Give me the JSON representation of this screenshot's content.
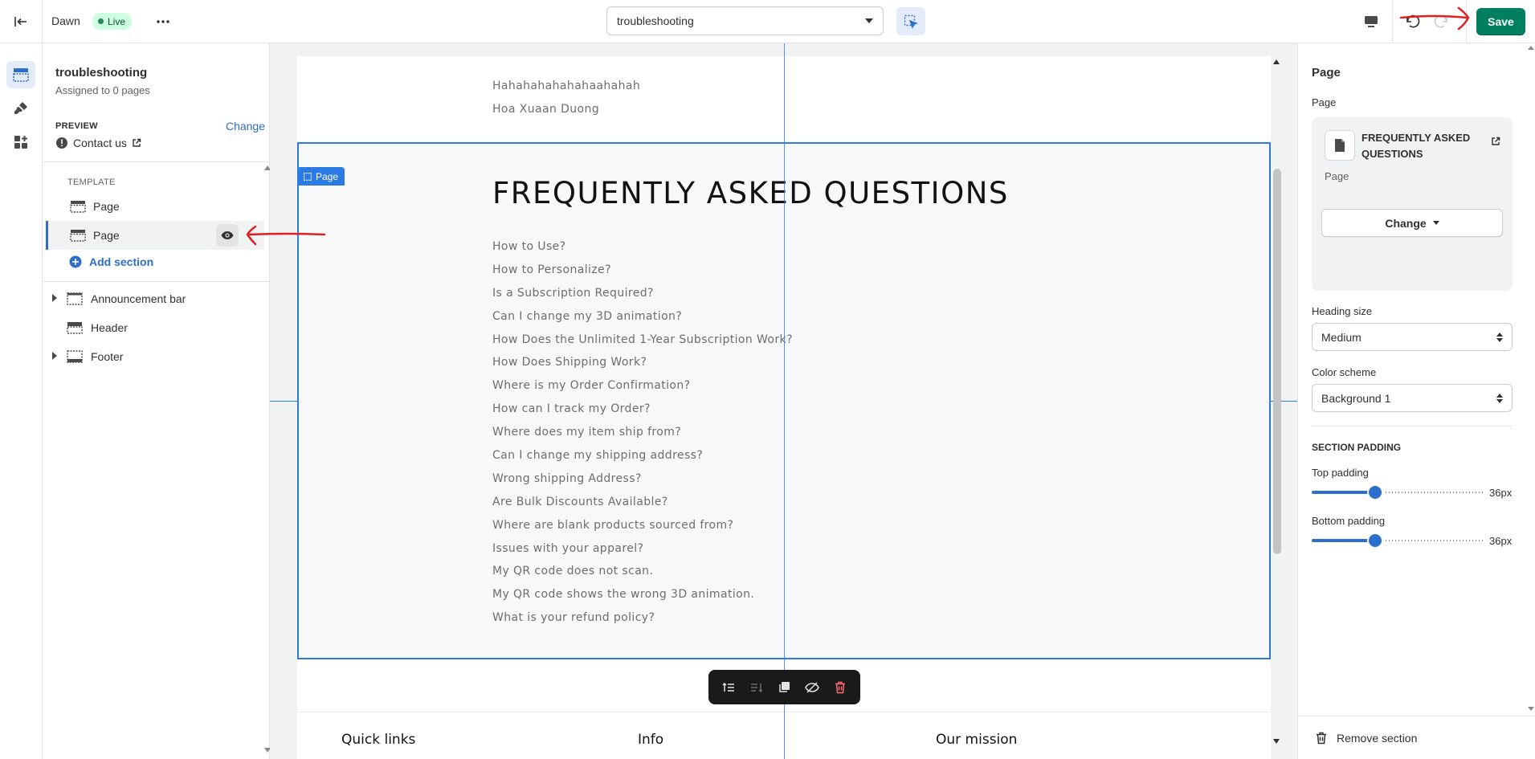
{
  "topbar": {
    "theme_name": "Dawn",
    "live_label": "Live",
    "template_select": "troubleshooting",
    "save_label": "Save"
  },
  "sidebar": {
    "title": "troubleshooting",
    "subtitle": "Assigned to 0 pages",
    "preview_label": "PREVIEW",
    "change_label": "Change",
    "preview_page": "Contact us",
    "template_label": "TEMPLATE",
    "template_sections": [
      {
        "label": "Page"
      },
      {
        "label": "Page"
      }
    ],
    "add_section_label": "Add section",
    "groups": [
      {
        "label": "Announcement bar"
      },
      {
        "label": "Header"
      },
      {
        "label": "Footer"
      }
    ]
  },
  "canvas": {
    "top_lines": [
      "Hahahahahahahaahahah",
      "Hoa Xuaan Duong"
    ],
    "section_tag": "Page",
    "heading": "FREQUENTLY ASKED QUESTIONS",
    "questions": [
      "How to Use?",
      "How to Personalize?",
      "Is a Subscription Required?",
      "Can I change my 3D animation?",
      "How Does the Unlimited 1-Year Subscription Work?",
      "How Does Shipping Work?",
      "Where is my Order Confirmation?",
      "How can I track my Order?",
      "Where does my item ship from?",
      "Can I change my shipping address?",
      "Wrong shipping Address?",
      "Are Bulk Discounts Available?",
      "Where are blank products sourced from?",
      "Issues with your apparel?",
      "My QR code does not scan.",
      "My QR code shows the wrong 3D animation.",
      "What is your refund policy?"
    ],
    "footer_columns": [
      "Quick links",
      "Info",
      "Our mission"
    ]
  },
  "settings": {
    "title": "Page",
    "page_label": "Page",
    "page_card_title": "FREQUENTLY ASKED QUESTIONS",
    "page_card_sub": "Page",
    "change_label": "Change",
    "heading_size_label": "Heading size",
    "heading_size_value": "Medium",
    "color_scheme_label": "Color scheme",
    "color_scheme_value": "Background 1",
    "section_padding_label": "SECTION PADDING",
    "top_padding_label": "Top padding",
    "top_padding_value": "36px",
    "bottom_padding_label": "Bottom padding",
    "bottom_padding_value": "36px",
    "remove_label": "Remove section"
  },
  "colors": {
    "accent_blue": "#2c7be5",
    "save_green": "#008060",
    "annotation_red": "#e02020"
  }
}
